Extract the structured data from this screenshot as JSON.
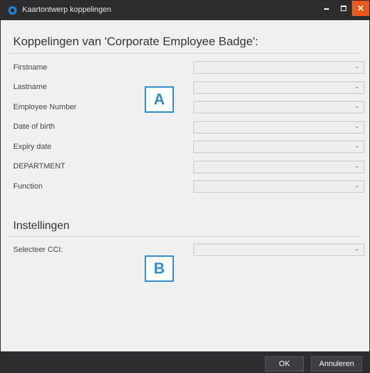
{
  "window": {
    "title": "Kaartontwerp koppelingen",
    "minimize_symbol": "",
    "close_symbol": "✕"
  },
  "main": {
    "heading": "Koppelingen van 'Corporate Employee Badge':",
    "fields": [
      {
        "label": "Firstname",
        "value": ""
      },
      {
        "label": "Lastname",
        "value": ""
      },
      {
        "label": "Employee Number",
        "value": ""
      },
      {
        "label": "Date of birth",
        "value": ""
      },
      {
        "label": "Expiry date",
        "value": ""
      },
      {
        "label": "DEPARTMENT",
        "value": ""
      },
      {
        "label": "Function",
        "value": ""
      }
    ]
  },
  "settings": {
    "heading": "Instellingen",
    "cci_label": "Selecteer CCI:",
    "cci_value": ""
  },
  "callouts": {
    "a": "A",
    "b": "B"
  },
  "footer": {
    "ok_label": "OK",
    "cancel_label": "Annuleren"
  },
  "icons": {
    "app": "app-logo-icon",
    "dropdown": "chevron-down-icon",
    "close": "close-icon"
  },
  "colors": {
    "titlebar": "#2d2d30",
    "close_button": "#e8591a",
    "callout_border": "#2e8bc6"
  }
}
